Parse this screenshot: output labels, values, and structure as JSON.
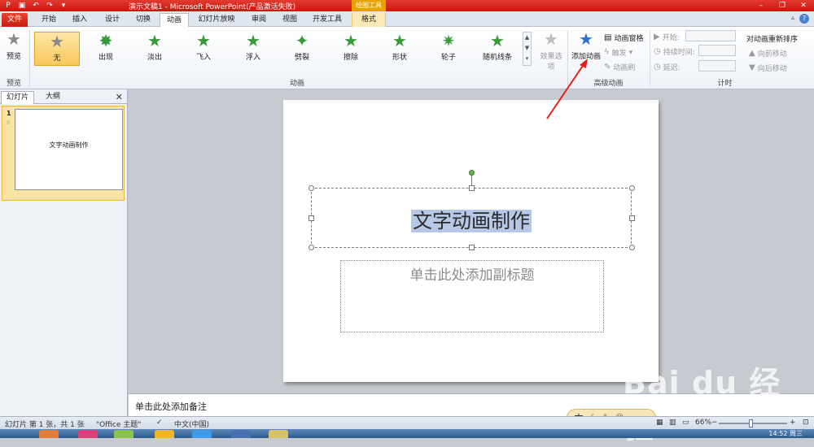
{
  "window": {
    "title": "演示文稿1 - Microsoft PowerPoint(产品激活失败)",
    "context_tab_title": "绘图工具"
  },
  "tabs": [
    {
      "label": "文件"
    },
    {
      "label": "开始"
    },
    {
      "label": "插入"
    },
    {
      "label": "设计"
    },
    {
      "label": "切换"
    },
    {
      "label": "动画"
    },
    {
      "label": "幻灯片放映"
    },
    {
      "label": "审阅"
    },
    {
      "label": "视图"
    },
    {
      "label": "开发工具"
    },
    {
      "label": "格式"
    }
  ],
  "ribbon": {
    "preview_group": {
      "button": "预览",
      "label": "预览"
    },
    "animation_group": {
      "label": "动画",
      "items": [
        "无",
        "出现",
        "淡出",
        "飞入",
        "浮入",
        "劈裂",
        "擦除",
        "形状",
        "轮子",
        "随机线条"
      ],
      "effect_options": "效果选项"
    },
    "advanced_group": {
      "label": "高级动画",
      "add_animation": "添加动画",
      "animation_pane": "动画窗格",
      "trigger": "触发",
      "animation_painter": "动画刷"
    },
    "timing_group": {
      "label": "计时",
      "start": "开始:",
      "duration": "持续时间:",
      "delay": "延迟:",
      "reorder_title": "对动画重新排序",
      "move_earlier": "向前移动",
      "move_later": "向后移动"
    }
  },
  "left_pane": {
    "tab_slides": "幻灯片",
    "tab_outline": "大纲",
    "slide_number": "1",
    "thumb_title": "文字动画制作"
  },
  "slide": {
    "title": "文字动画制作",
    "subtitle_placeholder": "单击此处添加副标题"
  },
  "notes": {
    "placeholder": "单击此处添加备注"
  },
  "status": {
    "slide_info": "幻灯片 第 1 张，共 1 张",
    "theme": "\"Office 主题\"",
    "language": "中文(中国)",
    "zoom": "66%"
  },
  "ime": {
    "mode": "中"
  },
  "watermark": {
    "brand": "Bai  du 经验",
    "url": "jingyan.baidu.com"
  },
  "taskbar": {
    "clock": "14:52 周三"
  },
  "colors": {
    "accent_red": "#c8160f",
    "context_orange": "#e8a200",
    "selected_anim": "#f8c85a",
    "selection_highlight": "#b7c8e6"
  }
}
